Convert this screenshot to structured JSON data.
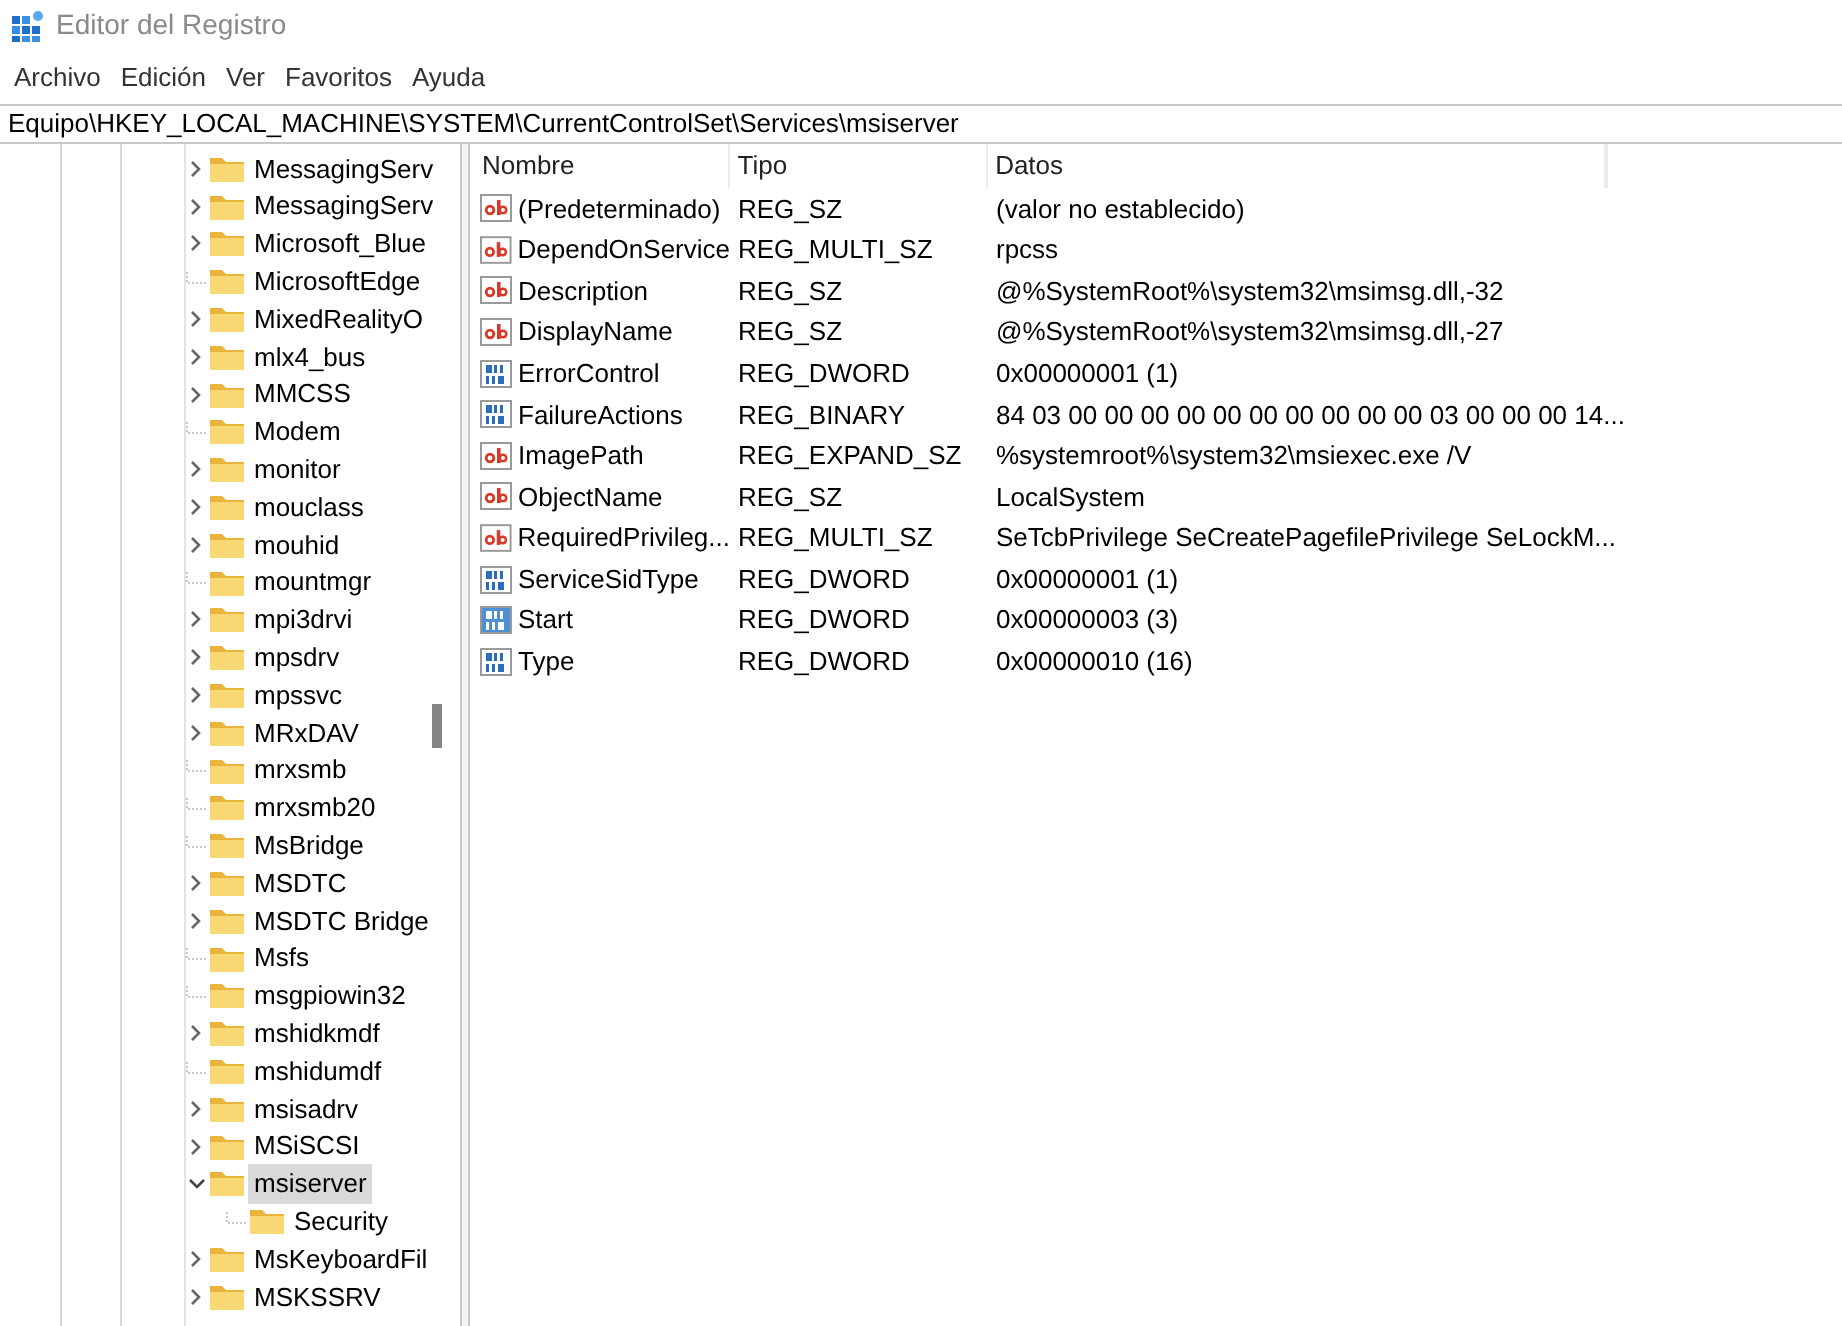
{
  "window": {
    "title": "Editor del Registro"
  },
  "menu": [
    "Archivo",
    "Edición",
    "Ver",
    "Favoritos",
    "Ayuda"
  ],
  "address": "Equipo\\HKEY_LOCAL_MACHINE\\SYSTEM\\CurrentControlSet\\Services\\msiserver",
  "tree": [
    {
      "label": "MessagingServ",
      "kind": "collapsed",
      "selected": false
    },
    {
      "label": "MessagingServ",
      "kind": "collapsed",
      "selected": false
    },
    {
      "label": "Microsoft_Blue",
      "kind": "collapsed",
      "selected": false
    },
    {
      "label": "MicrosoftEdge",
      "kind": "leaf",
      "selected": false
    },
    {
      "label": "MixedRealityO",
      "kind": "collapsed",
      "selected": false
    },
    {
      "label": "mlx4_bus",
      "kind": "collapsed",
      "selected": false
    },
    {
      "label": "MMCSS",
      "kind": "collapsed",
      "selected": false
    },
    {
      "label": "Modem",
      "kind": "leaf",
      "selected": false
    },
    {
      "label": "monitor",
      "kind": "collapsed",
      "selected": false
    },
    {
      "label": "mouclass",
      "kind": "collapsed",
      "selected": false
    },
    {
      "label": "mouhid",
      "kind": "collapsed",
      "selected": false
    },
    {
      "label": "mountmgr",
      "kind": "leaf",
      "selected": false
    },
    {
      "label": "mpi3drvi",
      "kind": "collapsed",
      "selected": false
    },
    {
      "label": "mpsdrv",
      "kind": "collapsed",
      "selected": false
    },
    {
      "label": "mpssvc",
      "kind": "collapsed",
      "selected": false
    },
    {
      "label": "MRxDAV",
      "kind": "collapsed",
      "selected": false
    },
    {
      "label": "mrxsmb",
      "kind": "leaf",
      "selected": false
    },
    {
      "label": "mrxsmb20",
      "kind": "leaf",
      "selected": false
    },
    {
      "label": "MsBridge",
      "kind": "leaf",
      "selected": false
    },
    {
      "label": "MSDTC",
      "kind": "collapsed",
      "selected": false
    },
    {
      "label": "MSDTC Bridge",
      "kind": "collapsed",
      "selected": false
    },
    {
      "label": "Msfs",
      "kind": "leaf",
      "selected": false
    },
    {
      "label": "msgpiowin32",
      "kind": "leaf",
      "selected": false
    },
    {
      "label": "mshidkmdf",
      "kind": "collapsed",
      "selected": false
    },
    {
      "label": "mshidumdf",
      "kind": "leaf",
      "selected": false
    },
    {
      "label": "msisadrv",
      "kind": "collapsed",
      "selected": false
    },
    {
      "label": "MSiSCSI",
      "kind": "collapsed",
      "selected": false
    },
    {
      "label": "msiserver",
      "kind": "expanded",
      "selected": true,
      "children": [
        {
          "label": "Security",
          "kind": "leaf",
          "selected": false
        }
      ]
    },
    {
      "label": "MsKeyboardFil",
      "kind": "collapsed",
      "selected": false
    },
    {
      "label": "MSKSSRV",
      "kind": "collapsed",
      "selected": false
    }
  ],
  "values": {
    "columns": [
      "Nombre",
      "Tipo",
      "Datos"
    ],
    "rows": [
      {
        "kind": "string",
        "name": "(Predeterminado)",
        "type": "REG_SZ",
        "data": "(valor no establecido)",
        "selected": false
      },
      {
        "kind": "string",
        "name": "DependOnService",
        "type": "REG_MULTI_SZ",
        "data": "rpcss",
        "selected": false
      },
      {
        "kind": "string",
        "name": "Description",
        "type": "REG_SZ",
        "data": "@%SystemRoot%\\system32\\msimsg.dll,-32",
        "selected": false
      },
      {
        "kind": "string",
        "name": "DisplayName",
        "type": "REG_SZ",
        "data": "@%SystemRoot%\\system32\\msimsg.dll,-27",
        "selected": false
      },
      {
        "kind": "binary",
        "name": "ErrorControl",
        "type": "REG_DWORD",
        "data": "0x00000001 (1)",
        "selected": false
      },
      {
        "kind": "binary",
        "name": "FailureActions",
        "type": "REG_BINARY",
        "data": "84 03 00 00 00 00 00 00 00 00 00 00 03 00 00 00 14...",
        "selected": false
      },
      {
        "kind": "string",
        "name": "ImagePath",
        "type": "REG_EXPAND_SZ",
        "data": "%systemroot%\\system32\\msiexec.exe /V",
        "selected": false
      },
      {
        "kind": "string",
        "name": "ObjectName",
        "type": "REG_SZ",
        "data": "LocalSystem",
        "selected": false
      },
      {
        "kind": "string",
        "name": "RequiredPrivileg...",
        "type": "REG_MULTI_SZ",
        "data": "SeTcbPrivilege SeCreatePagefilePrivilege SeLockM...",
        "selected": false
      },
      {
        "kind": "binary",
        "name": "ServiceSidType",
        "type": "REG_DWORD",
        "data": "0x00000001 (1)",
        "selected": false
      },
      {
        "kind": "binary",
        "name": "Start",
        "type": "REG_DWORD",
        "data": "0x00000003 (3)",
        "selected": true
      },
      {
        "kind": "binary",
        "name": "Type",
        "type": "REG_DWORD",
        "data": "0x00000010 (16)",
        "selected": false
      }
    ]
  }
}
